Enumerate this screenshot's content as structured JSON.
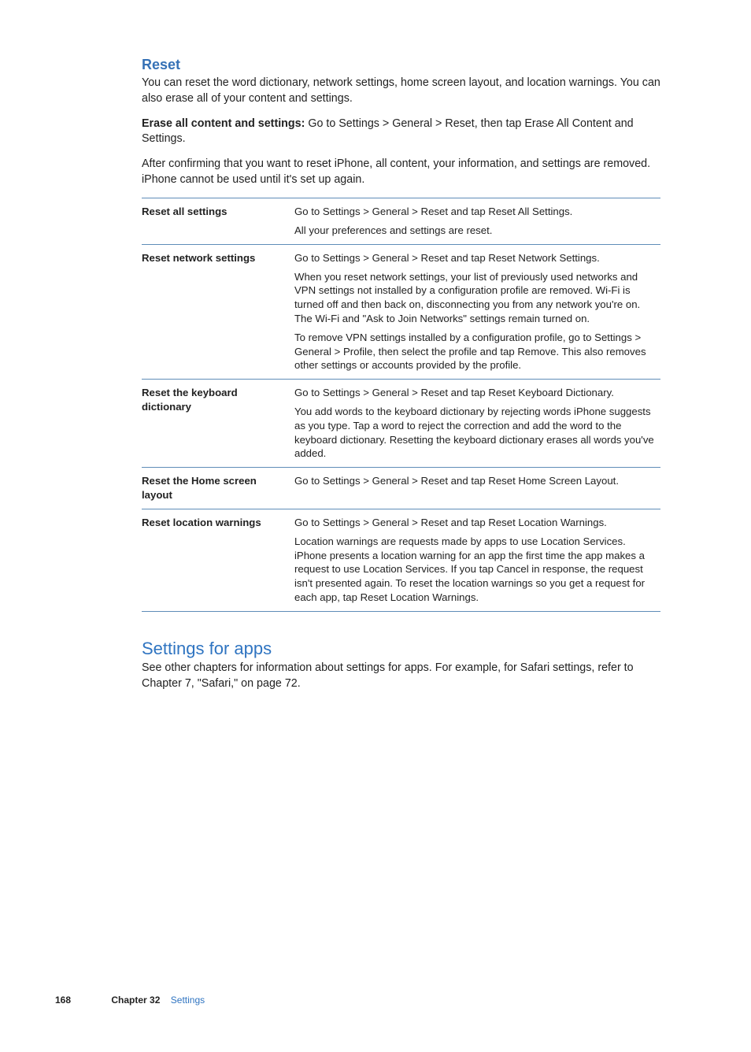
{
  "reset": {
    "heading": "Reset",
    "intro": "You can reset the word dictionary, network settings, home screen layout, and location warnings. You can also erase all of your content and settings.",
    "erase_bold": "Erase all content and settings:  ",
    "erase_rest": "Go to Settings > General > Reset, then tap Erase All Content and Settings.",
    "after": "After confirming that you want to reset iPhone, all content, your information, and settings are removed. iPhone cannot be used until it's set up again."
  },
  "rows": {
    "r0": {
      "label": "Reset all settings",
      "p1": "Go to Settings > General > Reset and tap Reset All Settings.",
      "p2": "All your preferences and settings are reset."
    },
    "r1": {
      "label": "Reset network settings",
      "p1": "Go to Settings > General > Reset and tap Reset Network Settings.",
      "p2": "When you reset network settings, your list of previously used networks and VPN settings not installed by a configuration profile are removed. Wi-Fi is turned off and then back on, disconnecting you from any network you're on. The Wi-Fi and \"Ask to Join Networks\" settings remain turned on.",
      "p3": "To remove VPN settings installed by a configuration profile, go to Settings > General > Profile, then select the profile and tap Remove. This also removes other settings or accounts provided by the profile."
    },
    "r2": {
      "label": "Reset the keyboard dictionary",
      "p1": "Go to Settings > General > Reset and tap Reset Keyboard Dictionary.",
      "p2": "You add words to the keyboard dictionary by rejecting words iPhone suggests as you type. Tap a word to reject the correction and add the word to the keyboard dictionary. Resetting the keyboard dictionary erases all words you've added."
    },
    "r3": {
      "label": "Reset the Home screen layout",
      "p1": "Go to Settings > General > Reset and tap Reset Home Screen Layout."
    },
    "r4": {
      "label": "Reset location warnings",
      "p1": "Go to Settings > General > Reset and tap Reset Location Warnings.",
      "p2": "Location warnings are requests made by apps to use Location Services. iPhone presents a location warning for an app the first time the app makes a request to use Location Services. If you tap Cancel in response, the request isn't presented again. To reset the location warnings so you get a request for each app, tap Reset Location Warnings."
    }
  },
  "apps": {
    "heading": "Settings for apps",
    "body": "See other chapters for information about settings for apps. For example, for Safari settings, refer to Chapter 7, \"Safari,\" on page 72."
  },
  "footer": {
    "page": "168",
    "chapter_label": "Chapter 32",
    "chapter_title": "Settings"
  }
}
